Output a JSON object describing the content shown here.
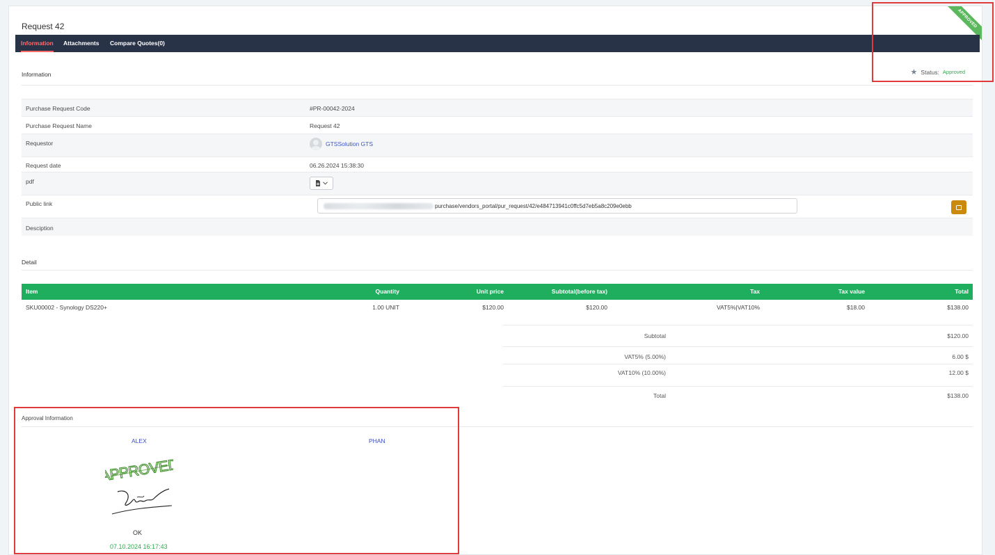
{
  "page": {
    "title": "Request 42",
    "ribbon": "APPROVED"
  },
  "tabs": [
    {
      "label": "Information",
      "active": true
    },
    {
      "label": "Attachments",
      "active": false
    },
    {
      "label": "Compare Quotes(0)",
      "active": false
    }
  ],
  "info_section": {
    "label": "Information",
    "status_label": "Status:",
    "status_value": "Approved",
    "rows": {
      "code": {
        "label": "Purchase Request Code",
        "value": "#PR-00042-2024"
      },
      "name": {
        "label": "Purchase Request Name",
        "value": "Request 42"
      },
      "requestor": {
        "label": "Requestor",
        "value": "GTSSolution GTS"
      },
      "date": {
        "label": "Request date",
        "value": "06.26.2024 15:38:30"
      },
      "pdf": {
        "label": "pdf",
        "button_icon": "file-pdf-icon",
        "dropdown_icon": "chevron-down-icon"
      },
      "public_link": {
        "label": "Public link",
        "value": "purchase/vendors_portal/pur_request/42/e484713941c0ffc5d7eb5a8c209e0ebb"
      },
      "description": {
        "label": "Desciption",
        "value": ""
      }
    }
  },
  "detail": {
    "label": "Detail",
    "columns": [
      "Item",
      "Quantity",
      "Unit price",
      "Subtotal(before tax)",
      "Tax",
      "Tax value",
      "Total"
    ],
    "rows": [
      [
        "SKU00002 - Synology DS220+",
        "1.00 UNIT",
        "$120.00",
        "$120.00",
        "VAT5%|VAT10%",
        "$18.00",
        "$138.00"
      ]
    ],
    "totals": [
      {
        "label": "Subtotal",
        "value": "$120.00"
      },
      {
        "label": "VAT5% (5.00%)",
        "value": "6.00 $"
      },
      {
        "label": "VAT10% (10.00%)",
        "value": "12.00 $"
      },
      {
        "label": "Total",
        "value": "$138.00"
      }
    ]
  },
  "approval": {
    "label": "Approval Information",
    "approvers": [
      {
        "name": "ALEX",
        "stamp": "APPROVED",
        "note": "OK",
        "date": "07.10.2024 16:17:43"
      },
      {
        "name": "PHAN"
      }
    ]
  },
  "colors": {
    "tabbar": "#283347",
    "active_tab": "#ff6b6b",
    "table_header": "#1fae5e",
    "approved": "#2fa84f",
    "copy_button": "#c98a0e",
    "highlight": "#e03a3a"
  }
}
